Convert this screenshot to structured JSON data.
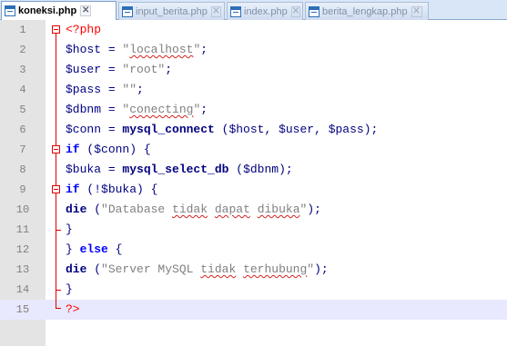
{
  "tabs": [
    {
      "label": "koneksi.php",
      "active": true
    },
    {
      "label": "input_berita.php",
      "active": false
    },
    {
      "label": "index.php",
      "active": false
    },
    {
      "label": "berita_lengkap.php",
      "active": false
    }
  ],
  "tab_close_glyph": "✕",
  "line_numbers": [
    "1",
    "2",
    "3",
    "4",
    "5",
    "6",
    "7",
    "8",
    "9",
    "10",
    "11",
    "12",
    "13",
    "14",
    "15"
  ],
  "code": {
    "l1": {
      "open": "<?php"
    },
    "l2": {
      "var": "$host",
      "eq": " = ",
      "q1": "\"",
      "word": "localhost",
      "q2": "\"",
      "end": ";"
    },
    "l3": {
      "var": "$user",
      "eq": " = ",
      "str": "\"root\"",
      "end": ";"
    },
    "l4": {
      "var": "$pass",
      "eq": " = ",
      "str": "\"\"",
      "end": ";"
    },
    "l5": {
      "var": "$dbnm",
      "eq": " = ",
      "q1": "\"",
      "word": "conecting",
      "q2": "\"",
      "end": ";"
    },
    "l6": {
      "var": "$conn",
      "eq": " = ",
      "fn": "mysql_connect",
      "args_open": " (",
      "a1": "$host",
      "c1": ", ",
      "a2": "$user",
      "c2": ", ",
      "a3": "$pass",
      "args_close": ");"
    },
    "l7": {
      "kw": "if",
      "p1": " (",
      "var": "$conn",
      "p2": ") {"
    },
    "l8": {
      "var": "$buka",
      "eq": " = ",
      "fn": "mysql_select_db",
      "p1": " (",
      "arg": "$dbnm",
      "p2": ");"
    },
    "l9": {
      "kw": "if",
      "p1": " (!",
      "var": "$buka",
      "p2": ") {"
    },
    "l10": {
      "fn": "die",
      "p1": " (",
      "s1": "\"Database ",
      "w1": "tidak",
      "sp1": " ",
      "w2": "dapat",
      "sp2": " ",
      "w3": "dibuka",
      "s2": "\"",
      "p2": ");"
    },
    "l11": {
      "text": "}"
    },
    "l12": {
      "b": "} ",
      "kw": "else",
      "b2": " {"
    },
    "l13": {
      "fn": "die",
      "p1": " (",
      "s1": "\"Server MySQL ",
      "w1": "tidak",
      "sp1": " ",
      "w2": "terhubung",
      "s2": "\"",
      "p2": ");"
    },
    "l14": {
      "text": "}"
    },
    "l15": {
      "close": "?>"
    }
  },
  "colors": {
    "php_tag": "#ff0000",
    "keyword": "#0000ff",
    "variable": "#000080",
    "string": "#808080",
    "gutter": "#e4e4e4",
    "current_line": "#e8e8ff"
  },
  "current_line": 15
}
